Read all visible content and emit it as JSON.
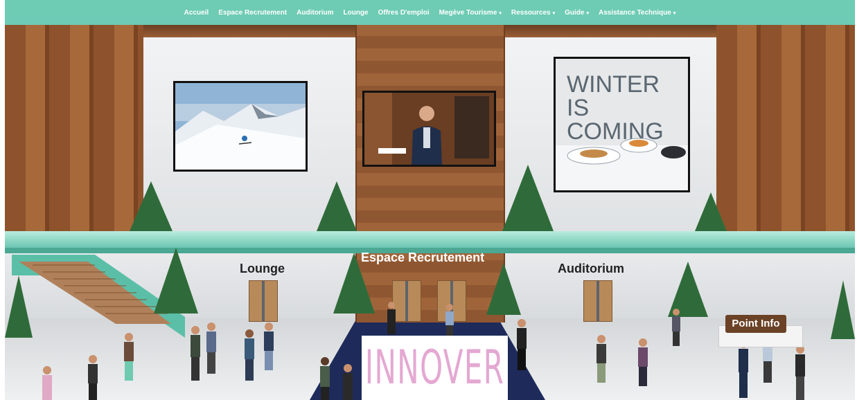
{
  "nav": {
    "items": [
      {
        "label": "Accueil",
        "dropdown": false
      },
      {
        "label": "Espace Recrutement",
        "dropdown": false
      },
      {
        "label": "Auditorium",
        "dropdown": false
      },
      {
        "label": "Lounge",
        "dropdown": false
      },
      {
        "label": "Offres D'emploi",
        "dropdown": false
      },
      {
        "label": "Megève Tourisme",
        "dropdown": true
      },
      {
        "label": "Ressources",
        "dropdown": true
      },
      {
        "label": "Guide",
        "dropdown": true
      },
      {
        "label": "Assistance Technique",
        "dropdown": true
      }
    ],
    "caret": "▾",
    "background_color": "#6ecbb4"
  },
  "scene": {
    "labels": {
      "lounge": "Lounge",
      "espace_recrutement": "Espace Recrutement",
      "auditorium": "Auditorium",
      "point_info": "Point Info"
    },
    "screens": {
      "winter_text": "WINTER IS COMING"
    }
  },
  "overlay": {
    "innover": "INNOVER",
    "color": "#e4a8d2"
  },
  "colors": {
    "accent_teal": "#6ecbb4",
    "wood": "#955a30",
    "carpet": "#1e2a5a"
  }
}
